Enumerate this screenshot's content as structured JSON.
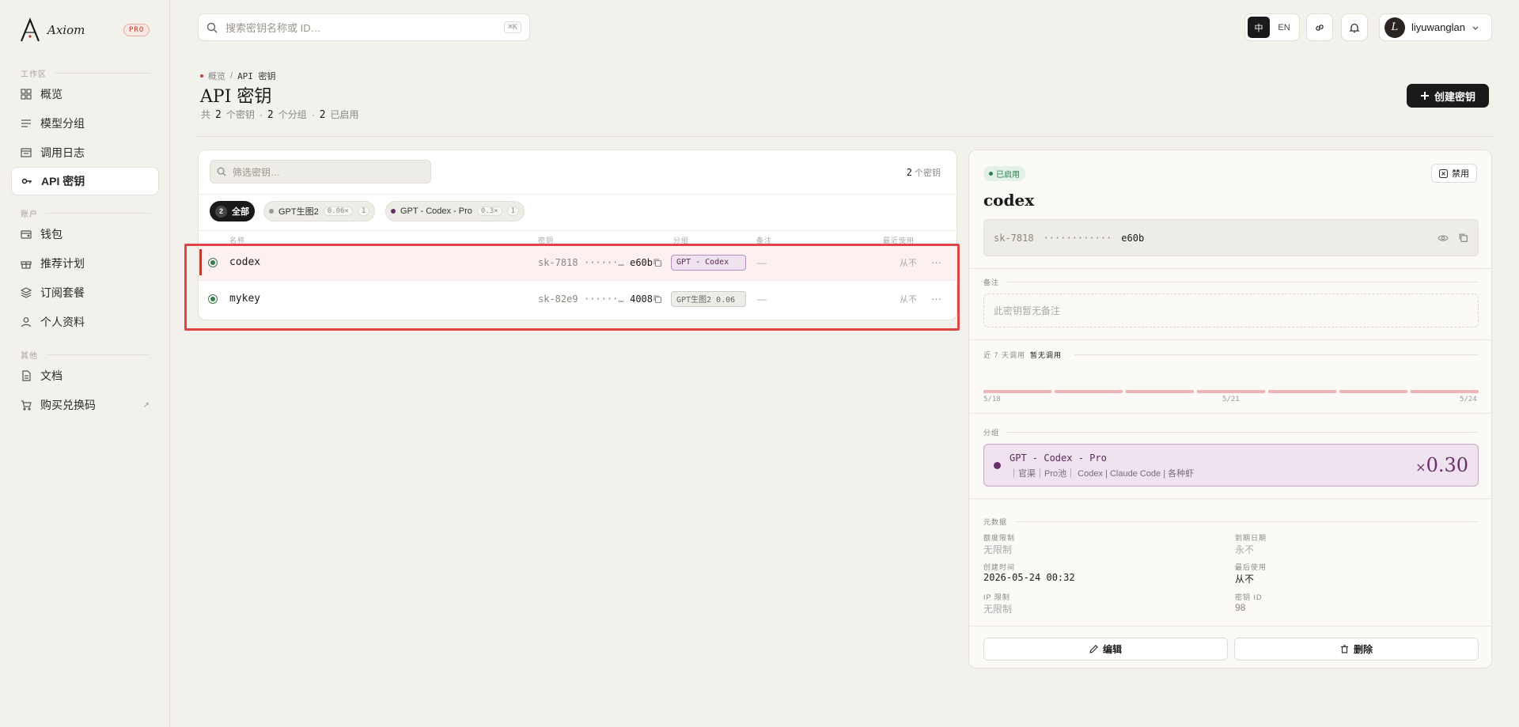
{
  "brand": {
    "name": "Axiom",
    "badge": "PRO"
  },
  "sidebar": {
    "sections": [
      {
        "label": "工作区"
      },
      {
        "label": "账户"
      },
      {
        "label": "其他"
      }
    ],
    "items": [
      {
        "label": "概览",
        "icon": "grid-icon"
      },
      {
        "label": "模型分组",
        "icon": "list-icon"
      },
      {
        "label": "调用日志",
        "icon": "log-icon"
      },
      {
        "label": "API 密钥",
        "icon": "key-icon",
        "active": true
      },
      {
        "label": "钱包",
        "icon": "wallet-icon"
      },
      {
        "label": "推荐计划",
        "icon": "gift-icon"
      },
      {
        "label": "订阅套餐",
        "icon": "layers-icon"
      },
      {
        "label": "个人资料",
        "icon": "user-icon"
      },
      {
        "label": "文档",
        "icon": "doc-icon"
      },
      {
        "label": "购买兑换码",
        "icon": "cart-icon",
        "external": "↗"
      }
    ]
  },
  "topbar": {
    "search_placeholder": "搜索密钥名称或 ID…",
    "shortcut": "⌘K",
    "lang": [
      "中",
      "EN"
    ],
    "user": {
      "initial": "L",
      "name": "liyuwanglan"
    }
  },
  "header": {
    "breadcrumb": [
      "概览",
      "API 密钥"
    ],
    "title": "API 密钥",
    "summary": {
      "prefix": "共",
      "keys": "2",
      "keys_label": "个密钥",
      "groups": "2",
      "groups_label": "个分组",
      "enabled": "2",
      "enabled_label": "已启用"
    },
    "create_label": "创建密钥"
  },
  "list": {
    "filter_placeholder": "筛选密钥…",
    "count": "2",
    "count_label": "个密钥",
    "chips": [
      {
        "label": "全部",
        "count": "2"
      },
      {
        "label": "GPT生图2",
        "mult": "0.06×",
        "count": "1"
      },
      {
        "label": "GPT - Codex - Pro",
        "mult": "0.3×",
        "count": "1"
      }
    ],
    "columns": [
      "名称",
      "密钥",
      "分组",
      "备注",
      "最近使用"
    ],
    "rows": [
      {
        "name": "codex",
        "key_prefix": "sk-7818",
        "key_mask": "······…",
        "key_suffix": "e60b",
        "group": "GPT - Codex",
        "note": "—",
        "last_used": "从不",
        "more": "···"
      },
      {
        "name": "mykey",
        "key_prefix": "sk-82e9",
        "key_mask": "······…",
        "key_suffix": "4008",
        "group": "GPT生图2 0.06",
        "note": "—",
        "last_used": "从不",
        "more": "···"
      }
    ]
  },
  "detail": {
    "status": "已启用",
    "disable_label": "禁用",
    "title": "codex",
    "key_prefix": "sk-7818",
    "key_mask": "············",
    "key_suffix": "e60b",
    "note_label": "备注",
    "note_placeholder": "此密钥暂无备注",
    "usage_label": "近 7 天调用",
    "usage_status": "暂无调用",
    "usage_series": [
      0,
      0,
      0,
      0,
      0,
      0,
      0
    ],
    "x_ticks": [
      "5/18",
      "5/21",
      "5/24"
    ],
    "group_label": "分组",
    "group": {
      "name": "GPT - Codex - Pro",
      "sub": "｜官渠｜Pro池｜ Codex | Claude Code | 各种虾",
      "mult_prefix": "×",
      "mult": "0.30"
    },
    "meta_label": "元数据",
    "meta": [
      {
        "label": "额度限制",
        "value": "无限制"
      },
      {
        "label": "到期日期",
        "value": "永不"
      },
      {
        "label": "创建时间",
        "value": "2026-05-24 00:32"
      },
      {
        "label": "最后使用",
        "value": "从不"
      },
      {
        "label": "IP 限制",
        "value": "无限制"
      },
      {
        "label": "密钥 ID",
        "value": "98"
      }
    ],
    "edit_label": "编辑",
    "delete_label": "删除"
  },
  "colors": {
    "accent": "#c0392b",
    "enabled": "#2e7d4f",
    "group_purple": "#6b2f6b",
    "highlight": "#e04545"
  }
}
